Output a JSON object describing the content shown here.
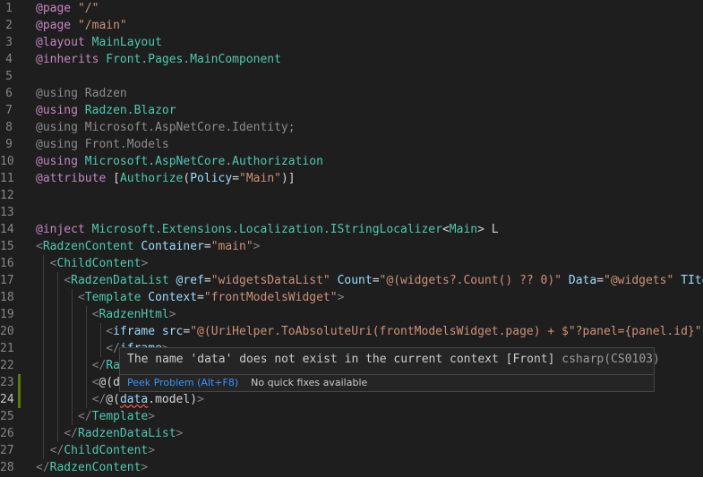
{
  "editor": {
    "language": "razor",
    "active_line": 24,
    "lines": [
      {
        "n": 1,
        "mod": false,
        "tokens": [
          [
            "dir",
            "@page"
          ],
          [
            "txt",
            " "
          ],
          [
            "str",
            "\"/\""
          ]
        ]
      },
      {
        "n": 2,
        "mod": false,
        "tokens": [
          [
            "dir",
            "@page"
          ],
          [
            "txt",
            " "
          ],
          [
            "str",
            "\"/main\""
          ]
        ]
      },
      {
        "n": 3,
        "mod": false,
        "tokens": [
          [
            "dir",
            "@layout"
          ],
          [
            "txt",
            " "
          ],
          [
            "type",
            "MainLayout"
          ]
        ]
      },
      {
        "n": 4,
        "mod": false,
        "tokens": [
          [
            "dir",
            "@inherits"
          ],
          [
            "txt",
            " "
          ],
          [
            "type",
            "Front.Pages.MainComponent"
          ]
        ]
      },
      {
        "n": 5,
        "mod": false,
        "tokens": []
      },
      {
        "n": 6,
        "mod": false,
        "tokens": [
          [
            "dim",
            "@using Radzen"
          ]
        ]
      },
      {
        "n": 7,
        "mod": false,
        "tokens": [
          [
            "dir",
            "@using"
          ],
          [
            "txt",
            " "
          ],
          [
            "type",
            "Radzen.Blazor"
          ]
        ]
      },
      {
        "n": 8,
        "mod": false,
        "tokens": [
          [
            "dim",
            "@using Microsoft.AspNetCore.Identity;"
          ]
        ]
      },
      {
        "n": 9,
        "mod": false,
        "tokens": [
          [
            "dim",
            "@using Front.Models"
          ]
        ]
      },
      {
        "n": 10,
        "mod": false,
        "tokens": [
          [
            "dir",
            "@using"
          ],
          [
            "txt",
            " "
          ],
          [
            "type",
            "Microsoft.AspNetCore.Authorization"
          ]
        ]
      },
      {
        "n": 11,
        "mod": false,
        "tokens": [
          [
            "dir",
            "@attribute"
          ],
          [
            "txt",
            " ["
          ],
          [
            "type",
            "Authorize"
          ],
          [
            "txt",
            "("
          ],
          [
            "var",
            "Policy"
          ],
          [
            "txt",
            "="
          ],
          [
            "str",
            "\"Main\""
          ],
          [
            "txt",
            ")]"
          ]
        ]
      },
      {
        "n": 12,
        "mod": false,
        "tokens": []
      },
      {
        "n": 13,
        "mod": false,
        "tokens": []
      },
      {
        "n": 14,
        "mod": false,
        "tokens": [
          [
            "dir",
            "@inject"
          ],
          [
            "txt",
            " "
          ],
          [
            "type",
            "Microsoft.Extensions.Localization.IStringLocalizer"
          ],
          [
            "txt",
            "<"
          ],
          [
            "type",
            "Main"
          ],
          [
            "txt",
            "> L"
          ]
        ]
      },
      {
        "n": 15,
        "mod": false,
        "tokens": [
          [
            "pun",
            "<"
          ],
          [
            "tag",
            "RadzenContent"
          ],
          [
            "txt",
            " "
          ],
          [
            "attr",
            "Container"
          ],
          [
            "txt",
            "="
          ],
          [
            "str",
            "\"main\""
          ],
          [
            "pun",
            ">"
          ]
        ]
      },
      {
        "n": 16,
        "mod": false,
        "tokens": [
          [
            "txt",
            "  "
          ],
          [
            "pun",
            "<"
          ],
          [
            "tag",
            "ChildContent"
          ],
          [
            "pun",
            ">"
          ]
        ]
      },
      {
        "n": 17,
        "mod": false,
        "tokens": [
          [
            "txt",
            "    "
          ],
          [
            "pun",
            "<"
          ],
          [
            "tag",
            "RadzenDataList"
          ],
          [
            "txt",
            " "
          ],
          [
            "attr",
            "@ref"
          ],
          [
            "txt",
            "="
          ],
          [
            "str",
            "\"widgetsDataList\""
          ],
          [
            "txt",
            " "
          ],
          [
            "attr",
            "Count"
          ],
          [
            "txt",
            "="
          ],
          [
            "str",
            "\"@(widgets?.Count() ?? 0)\""
          ],
          [
            "txt",
            " "
          ],
          [
            "attr",
            "Data"
          ],
          [
            "txt",
            "="
          ],
          [
            "str",
            "\"@widgets\""
          ],
          [
            "txt",
            " "
          ],
          [
            "attr",
            "TItem"
          ]
        ]
      },
      {
        "n": 18,
        "mod": false,
        "tokens": [
          [
            "txt",
            "      "
          ],
          [
            "pun",
            "<"
          ],
          [
            "tag",
            "Template"
          ],
          [
            "txt",
            " "
          ],
          [
            "attr",
            "Context"
          ],
          [
            "txt",
            "="
          ],
          [
            "str",
            "\"frontModelsWidget\""
          ],
          [
            "pun",
            ">"
          ]
        ]
      },
      {
        "n": 19,
        "mod": false,
        "tokens": [
          [
            "txt",
            "        "
          ],
          [
            "pun",
            "<"
          ],
          [
            "tag",
            "RadzenHtml"
          ],
          [
            "pun",
            ">"
          ]
        ]
      },
      {
        "n": 20,
        "mod": false,
        "tokens": [
          [
            "txt",
            "          "
          ],
          [
            "pun",
            "<"
          ],
          [
            "attr",
            "iframe"
          ],
          [
            "txt",
            " "
          ],
          [
            "attr",
            "src"
          ],
          [
            "txt",
            "="
          ],
          [
            "str",
            "\"@(UriHelper.ToAbsoluteUri(frontModelsWidget.page) + $\"?panel={panel.id}\")\""
          ]
        ]
      },
      {
        "n": 21,
        "mod": false,
        "tokens": [
          [
            "txt",
            "          "
          ],
          [
            "pun",
            "</"
          ],
          [
            "attr",
            "iframe"
          ],
          [
            "pun",
            ">"
          ]
        ]
      },
      {
        "n": 22,
        "mod": false,
        "tokens": [
          [
            "txt",
            "        "
          ],
          [
            "pun",
            "</"
          ],
          [
            "tag",
            "RadzenHtml"
          ],
          [
            "pun",
            ">"
          ]
        ]
      },
      {
        "n": 23,
        "mod": true,
        "tokens": [
          [
            "txt",
            "        "
          ],
          [
            "pun",
            "<"
          ],
          [
            "txt",
            "@(data.model)"
          ],
          [
            "pun",
            ">"
          ]
        ]
      },
      {
        "n": 24,
        "mod": true,
        "tokens": [
          [
            "txt",
            "        "
          ],
          [
            "pun",
            "</"
          ],
          [
            "txt",
            "@("
          ],
          [
            "err",
            "data"
          ],
          [
            "txt",
            ".model)"
          ],
          [
            "pun",
            ">"
          ]
        ]
      },
      {
        "n": 25,
        "mod": false,
        "tokens": [
          [
            "txt",
            "      "
          ],
          [
            "pun",
            "</"
          ],
          [
            "tag",
            "Template"
          ],
          [
            "pun",
            ">"
          ]
        ]
      },
      {
        "n": 26,
        "mod": false,
        "tokens": [
          [
            "txt",
            "    "
          ],
          [
            "pun",
            "</"
          ],
          [
            "tag",
            "RadzenDataList"
          ],
          [
            "pun",
            ">"
          ]
        ]
      },
      {
        "n": 27,
        "mod": false,
        "tokens": [
          [
            "txt",
            "  "
          ],
          [
            "pun",
            "</"
          ],
          [
            "tag",
            "ChildContent"
          ],
          [
            "pun",
            ">"
          ]
        ]
      },
      {
        "n": 28,
        "mod": false,
        "tokens": [
          [
            "pun",
            "</"
          ],
          [
            "tag",
            "RadzenContent"
          ],
          [
            "pun",
            ">"
          ]
        ]
      }
    ]
  },
  "hover": {
    "message": "The name 'data' does not exist in the current context [Front]",
    "source": "csharp(CS0103)",
    "peek_label": "Peek Problem (Alt+F8)",
    "no_fix_label": "No quick fixes available"
  }
}
